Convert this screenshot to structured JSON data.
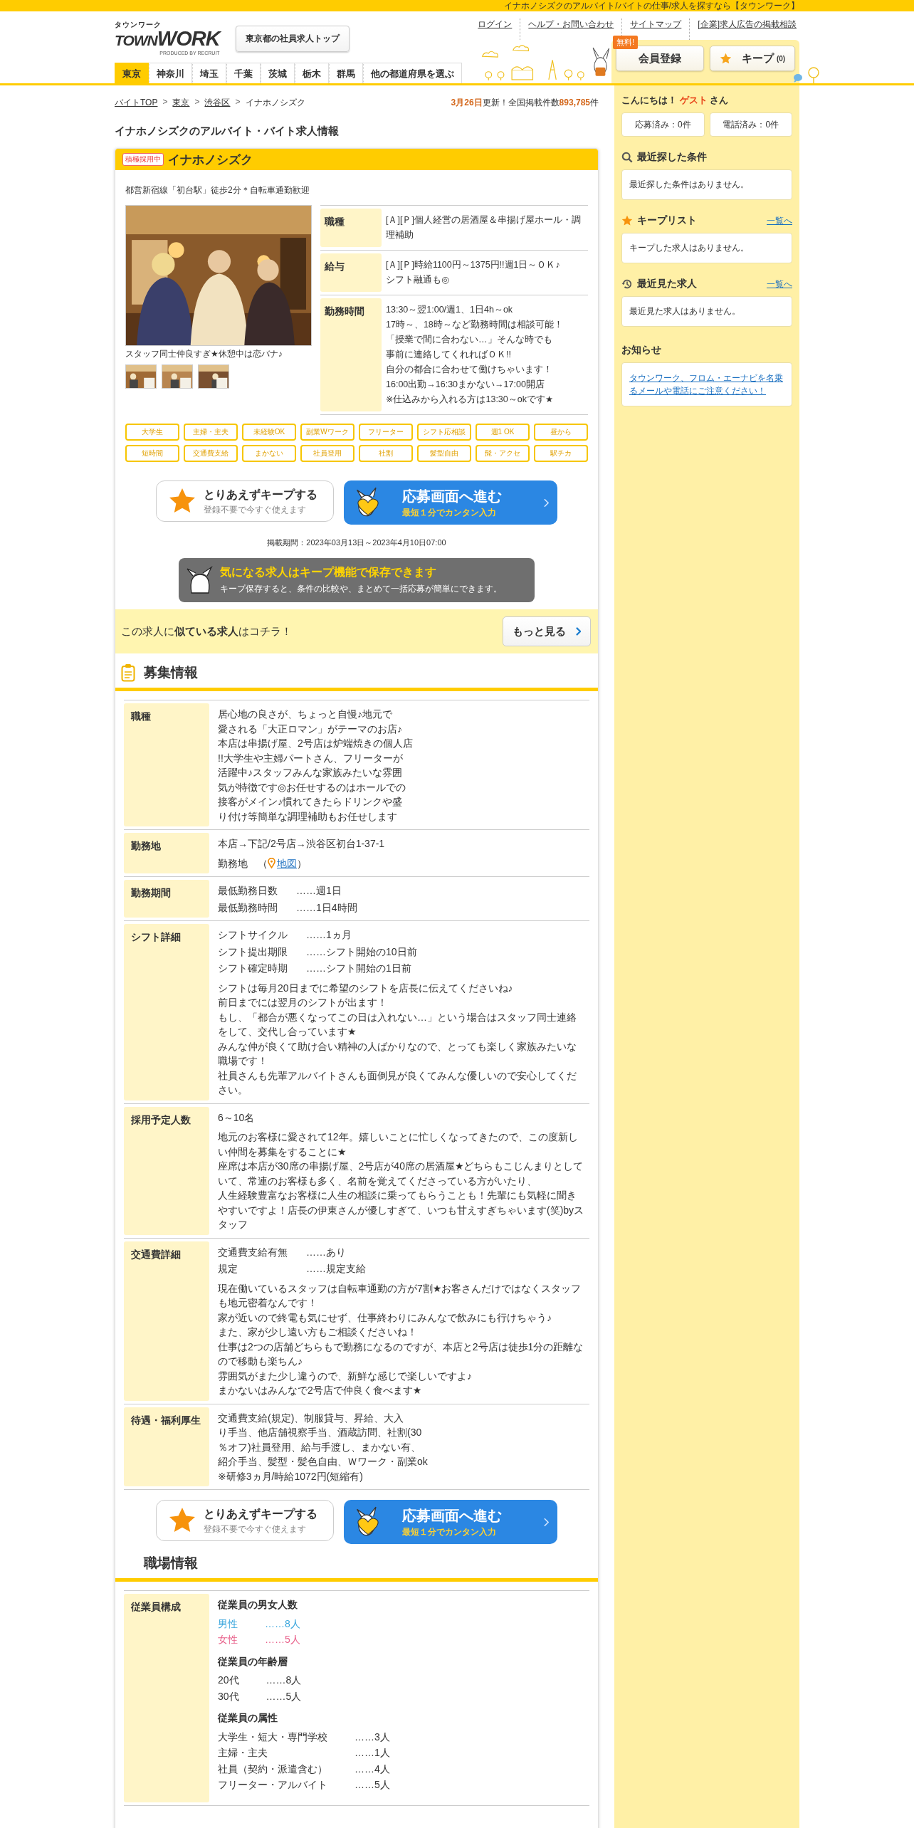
{
  "top_bar": {
    "text": "イナホノシズクのアルバイト/バイトの仕事/求人を探すなら【タウンワーク】"
  },
  "header": {
    "logo_kana": "タウンワーク",
    "logo_word_1": "TOWN",
    "logo_word_2": "WORK",
    "logo_tagline": "PRODUCED BY RECRUIT",
    "company_top": "東京都の社員求人トップ",
    "links": [
      "ログイン",
      "ヘルプ・お問い合わせ",
      "サイトマップ",
      "[企業]求人広告の掲載相談"
    ]
  },
  "prefecture_tabs": [
    {
      "label": "東京",
      "selected": true
    },
    {
      "label": "神奈川",
      "selected": false
    },
    {
      "label": "埼玉",
      "selected": false
    },
    {
      "label": "千葉",
      "selected": false
    },
    {
      "label": "茨城",
      "selected": false
    },
    {
      "label": "栃木",
      "selected": false
    },
    {
      "label": "群馬",
      "selected": false
    },
    {
      "label": "他の都道府県を選ぶ",
      "selected": false
    }
  ],
  "member": {
    "badge": "無料!",
    "register": "会員登録",
    "keep": "キープ",
    "keep_count": "(0)"
  },
  "breadcrumb": {
    "separator": ">",
    "items": [
      {
        "label": "バイトTOP",
        "link": true
      },
      {
        "label": "東京",
        "link": true
      },
      {
        "label": "渋谷区",
        "link": true
      },
      {
        "label": "イナホノシズク",
        "link": false
      }
    ]
  },
  "update": {
    "date": "3月26日",
    "text": "更新！全国掲載件数",
    "count": "893,785",
    "unit": "件"
  },
  "page_title": "イナホノシズクのアルバイト・バイト求人情報",
  "job": {
    "badge": "積極採用中",
    "name": "イナホノシズク",
    "access": "都営新宿線「初台駅」徒歩2分＊自転車通勤歓迎",
    "photo_caption": "スタッフ同士仲良すぎ★休憩中は恋バナ♪",
    "summary": [
      {
        "label": "職種",
        "lines": [
          "[Ａ][Ｐ]個人経営の居酒屋＆串揚げ屋ホール・調理補助"
        ]
      },
      {
        "label": "給与",
        "lines": [
          "[Ａ][Ｐ]時給1100円～1375円!!週1日～ＯＫ♪",
          "シフト融通も◎"
        ]
      },
      {
        "label": "勤務時間",
        "lines": [
          "13:30～翌1:00/週1、1日4h～ok",
          "17時～、18時～など勤務時間は相談可能！",
          "「授業で間に合わない…」そんな時でも",
          "事前に連絡してくれればＯＫ!!",
          "自分の都合に合わせて働けちゃいます！",
          "16:00出勤→16:30まかない→17:00開店",
          "※仕込みから入れる方は13:30～okです★"
        ]
      }
    ],
    "tags": [
      "大学生",
      "主婦・主夫",
      "未経験OK",
      "副業Wワーク",
      "フリーター",
      "シフト応相談",
      "週1 OK",
      "昼から",
      "短時間",
      "交通費支給",
      "まかない",
      "社員登用",
      "社割",
      "髪型自由",
      "髭・アクセ",
      "駅チカ"
    ],
    "cta": {
      "keep_title": "とりあえずキープする",
      "keep_sub": "登録不要で今すぐ使えます",
      "apply_title": "応募画面へ進む",
      "apply_sub": "最短１分でカンタン入力"
    },
    "period": "掲載期間：2023年03月13日～2023年4月10日07:00",
    "keep_banner": {
      "title": "気になる求人はキープ機能で保存できます",
      "sub": "キープ保存すると、条件の比較や、まとめて一括応募が簡単にできます。"
    },
    "similar": {
      "text": "この求人に**似ている求人**はコチラ！",
      "button": "もっと見る"
    }
  },
  "recruit": {
    "heading": "募集情報",
    "rows": [
      {
        "label": "職種",
        "blocks": [
          {
            "kind": "text",
            "lines": [
              "居心地の良さが、ちょっと自慢♪地元で",
              "愛される「大正ロマン」がテーマのお店♪",
              "本店は串揚げ屋、2号店は炉端焼きの個人店",
              "!!大学生や主婦パートさん、フリーターが",
              "活躍中♪スタッフみんな家族みたいな雰囲",
              "気が特徴です◎お任せするのはホールでの",
              "接客がメイン♪慣れてきたらドリンクや盛",
              "り付け等簡単な調理補助もお任せします"
            ]
          }
        ]
      },
      {
        "label": "勤務地",
        "blocks": [
          {
            "kind": "text",
            "lines": [
              "本店→下記/2号店→渋谷区初台1-37-1"
            ]
          },
          {
            "kind": "map",
            "prefix": "勤務地　（",
            "link": "地図",
            "suffix": "）"
          }
        ]
      },
      {
        "label": "勤務期間",
        "blocks": [
          {
            "kind": "pairs",
            "items": [
              {
                "key": "最低勤務日数",
                "value": "……週1日"
              },
              {
                "key": "最低勤務時間",
                "value": "……1日4時間"
              }
            ]
          }
        ]
      },
      {
        "label": "シフト詳細",
        "blocks": [
          {
            "kind": "pairs",
            "items": [
              {
                "key": "シフトサイクル",
                "value": "……1ヵ月"
              },
              {
                "key": "シフト提出期限",
                "value": "……シフト開始の10日前"
              },
              {
                "key": "シフト確定時期",
                "value": "……シフト開始の1日前"
              }
            ]
          },
          {
            "kind": "text",
            "lines": [
              "シフトは毎月20日までに希望のシフトを店長に伝えてくださいね♪",
              "前日までには翌月のシフトが出ます！",
              "もし、「都合が悪くなってこの日は入れない…」という場合はスタッフ同士連絡をして、交代し合っています★",
              "みんな仲が良くて助け合い精神の人ばかりなので、とっても楽しく家族みたいな職場です！",
              "社員さんも先輩アルバイトさんも面倒見が良くてみんな優しいので安心してください。"
            ]
          }
        ]
      },
      {
        "label": "採用予定人数",
        "blocks": [
          {
            "kind": "text",
            "lines": [
              "6～10名"
            ]
          },
          {
            "kind": "text",
            "lines": [
              "地元のお客様に愛されて12年。嬉しいことに忙しくなってきたので、この度新しい仲間を募集をすることに★",
              "座席は本店が30席の串揚げ屋、2号店が40席の居酒屋★どちらもこじんまりとしていて、常連のお客様も多く、名前を覚えてくださっている方がいたり、",
              "人生経験豊富なお客様に人生の相談に乗ってもらうことも！先輩にも気軽に聞きやすいですよ！店長の伊東さんが優しすぎて、いつも甘えすぎちゃいます(笑)byスタッフ"
            ]
          }
        ]
      },
      {
        "label": "交通費詳細",
        "blocks": [
          {
            "kind": "pairs",
            "items": [
              {
                "key": "交通費支給有無",
                "value": "……あり"
              },
              {
                "key": "規定",
                "value": "……規定支給"
              }
            ]
          },
          {
            "kind": "text",
            "lines": [
              "現在働いているスタッフは自転車通勤の方が7割★お客さんだけではなくスタッフも地元密着なんです！",
              "家が近いので終電も気にせず、仕事終わりにみんなで飲みにも行けちゃう♪",
              "また、家が少し遠い方もご相談くださいね！",
              "仕事は2つの店舗どちらもで勤務になるのですが、本店と2号店は徒歩1分の距離なので移動も楽ちん♪",
              "雰囲気がまた少し違うので、新鮮な感じで楽しいですよ♪",
              "まかないはみんなで2号店で仲良く食べます★"
            ]
          }
        ]
      },
      {
        "label": "待遇・福利厚生",
        "blocks": [
          {
            "kind": "text",
            "lines": [
              "交通費支給(規定)、制服貸与、昇給、大入",
              "り手当、他店舗視察手当、酒蔵訪問、社割(30",
              "％オフ)社員登用、給与手渡し、まかない有、",
              "紹介手当、髪型・髪色自由、Ｗワーク・副業ok",
              "※研修3ヵ月/時給1072円(短縮有)"
            ]
          }
        ]
      }
    ],
    "cta": {
      "keep_title": "とりあえずキープする",
      "keep_sub": "登録不要で今すぐ使えます",
      "apply_title": "応募画面へ進む",
      "apply_sub": "最短１分でカンタン入力"
    }
  },
  "workplace": {
    "heading": "職場情報",
    "rows": [
      {
        "label": "従業員構成",
        "groups": [
          {
            "title": "従業員の男女人数",
            "items": [
              {
                "key": "男性",
                "value": "……8人",
                "color": "#3aa6dd"
              },
              {
                "key": "女性",
                "value": "……5人",
                "color": "#e8608a"
              }
            ]
          },
          {
            "title": "従業員の年齢層",
            "items": [
              {
                "key": "20代",
                "value": "……8人"
              },
              {
                "key": "30代",
                "value": "……5人"
              }
            ]
          },
          {
            "title": "従業員の属性",
            "items": [
              {
                "key": "大学生・短大・専門学校",
                "value": "……3人"
              },
              {
                "key": "主婦・主夫",
                "value": "……1人"
              },
              {
                "key": "社員（契約・派遣含む）",
                "value": "……4人"
              },
              {
                "key": "フリーター・アルバイト",
                "value": "……5人"
              }
            ]
          }
        ]
      }
    ]
  },
  "sidebar": {
    "greeting_before": "こんにちは！",
    "guest": "ゲスト",
    "greeting_after": "さん",
    "counters": [
      "応募済み：0件",
      "電話済み：0件"
    ],
    "sections": [
      {
        "kind": "search",
        "title": "最近探した条件",
        "body": "最近探した条件はありません。"
      },
      {
        "kind": "star",
        "title": "キープリスト",
        "link": "一覧へ",
        "body": "キープした求人はありません。"
      },
      {
        "kind": "history",
        "title": "最近見た求人",
        "link": "一覧へ",
        "body": "最近見た求人はありません。"
      }
    ],
    "notice_title": "お知らせ",
    "notice_link": "タウンワーク、フロム・エーナビを名乗るメールや電話にご注意ください！"
  }
}
